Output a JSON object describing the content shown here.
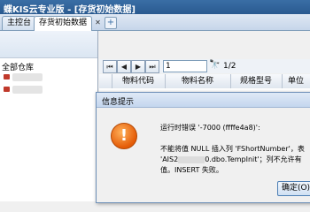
{
  "window": {
    "title": "蝶KIS云专业版 - [存货初始数据]"
  },
  "tabs": [
    {
      "label": "主控台"
    },
    {
      "label": "存货初始数据",
      "close": "✕"
    }
  ],
  "tab_add": "+",
  "tree": {
    "root": "全部仓库"
  },
  "toolbar": {
    "page_value": "1",
    "page_count": "1/2"
  },
  "grid": {
    "columns": [
      "物料代码",
      "物料名称",
      "规格型号",
      "单位"
    ]
  },
  "dialog": {
    "title": "信息提示",
    "line1": "运行时错误 '-7000 (ffffe4a8)':",
    "line2": "不能将值 NULL 插入列 'FShortNumber'，表",
    "line3_prefix": "'AIS2",
    "line3_suffix": "0.dbo.TempInit'；列不允许有",
    "line4": "值。INSERT 失败。",
    "ok_label": "确定(O)"
  }
}
